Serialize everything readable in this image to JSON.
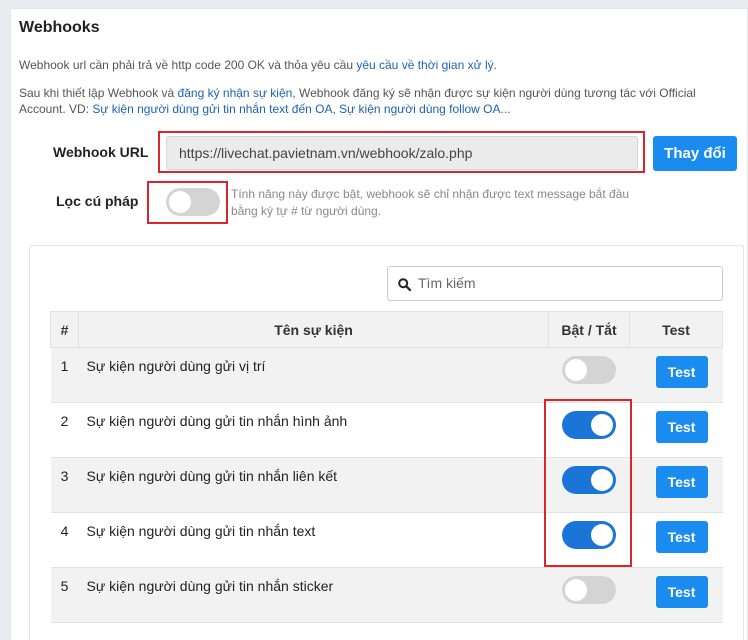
{
  "header": {
    "title": "Webhooks"
  },
  "description": {
    "line1_text": "Webhook url cần phải trả về http code 200 OK và thỏa yêu cầu ",
    "line1_link": "yêu cầu về thời gian xử lý",
    "line1_end": ".",
    "line2_a": "Sau khi thiết lập Webhook và ",
    "line2_link1": "đăng ký nhận sự kiện",
    "line2_b": ", Webhook đăng ký sẽ nhận được sự kiện người dùng tương tác với Official Account. VD: ",
    "line2_link2": "Sự kiện người dùng gửi tin nhắn text đến OA",
    "line2_c": ", ",
    "line2_link3": "Sự kiện người dùng follow OA..."
  },
  "webhook_url": {
    "label": "Webhook URL",
    "value": "https://livechat.pavietnam.vn/webhook/zalo.php",
    "change_button": "Thay đổi"
  },
  "syntax_filter": {
    "label": "Lọc cú pháp",
    "enabled": false,
    "hint": "Tính năng này được bật, webhook sẽ chỉ nhận được text message bắt đầu bằng ký tự # từ người dùng."
  },
  "search": {
    "placeholder": "Tìm kiếm"
  },
  "table": {
    "headers": [
      "#",
      "Tên sự kiện",
      "Bật / Tắt",
      "Test"
    ],
    "rows": [
      {
        "num": "1",
        "name": "Sự kiện người dùng gửi vị trí",
        "enabled": false,
        "test_label": "Test"
      },
      {
        "num": "2",
        "name": "Sự kiện người dùng gửi tin nhắn hình ảnh",
        "enabled": true,
        "test_label": "Test"
      },
      {
        "num": "3",
        "name": "Sự kiện người dùng gửi tin nhắn liên kết",
        "enabled": true,
        "test_label": "Test"
      },
      {
        "num": "4",
        "name": "Sự kiện người dùng gửi tin nhắn text",
        "enabled": true,
        "test_label": "Test"
      },
      {
        "num": "5",
        "name": "Sự kiện người dùng gửi tin nhắn sticker",
        "enabled": false,
        "test_label": "Test"
      }
    ]
  },
  "colors": {
    "primary": "#1a8cf0",
    "toggle_on": "#1a75d6",
    "highlight": "#d9262c"
  }
}
